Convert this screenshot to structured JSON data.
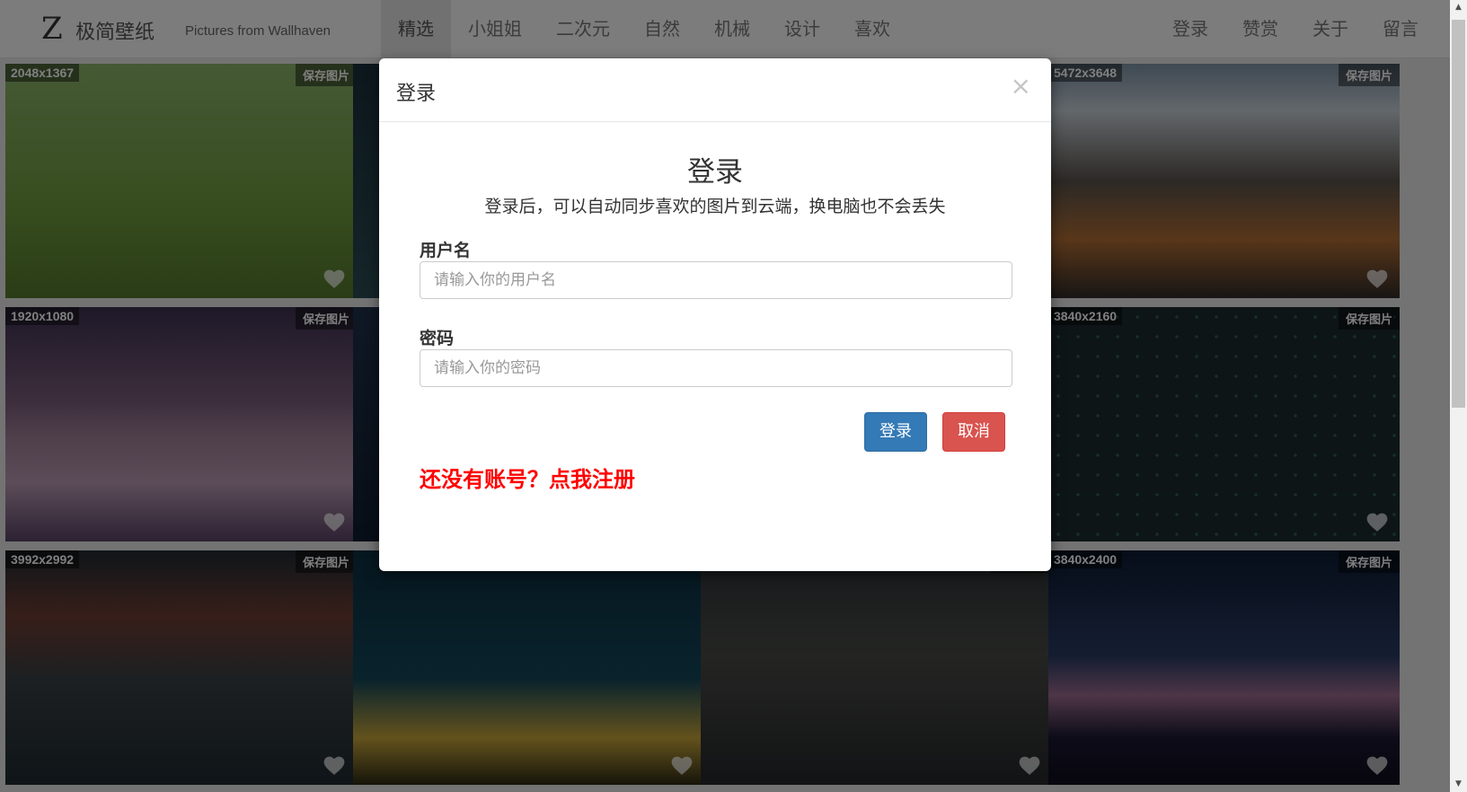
{
  "navbar": {
    "logo": "Z",
    "title": "极简壁纸",
    "subtitle": "Pictures from Wallhaven",
    "left_items": [
      {
        "label": "精选",
        "active": true
      },
      {
        "label": "小姐姐"
      },
      {
        "label": "二次元"
      },
      {
        "label": "自然"
      },
      {
        "label": "机械"
      },
      {
        "label": "设计"
      },
      {
        "label": "喜欢"
      }
    ],
    "right_items": [
      {
        "label": "登录"
      },
      {
        "label": "赞赏"
      },
      {
        "label": "关于"
      },
      {
        "label": "留言"
      }
    ]
  },
  "grid": {
    "save_label": "保存图片",
    "cards": [
      {
        "resolution": "2048x1367",
        "image": "woman-fence-field"
      },
      {
        "resolution": "",
        "image": "dark-abstract"
      },
      {
        "resolution": "",
        "image": "teal-abstract"
      },
      {
        "resolution": "5472x3648",
        "image": "mountain-road"
      },
      {
        "resolution": "1920x1080",
        "image": "pagoda-cherry-blossom"
      },
      {
        "resolution": "",
        "image": "night-sky"
      },
      {
        "resolution": "",
        "image": "dark-blue"
      },
      {
        "resolution": "3840x2160",
        "image": "doodle-pattern"
      },
      {
        "resolution": "3992x2992",
        "image": "sunset-pier"
      },
      {
        "resolution": "",
        "image": "eiffel-tower-night"
      },
      {
        "resolution": "",
        "image": "coastal-cliffs"
      },
      {
        "resolution": "3840x2400",
        "image": "forest-sunset"
      }
    ]
  },
  "modal": {
    "title": "登录",
    "close_icon": "×",
    "heading": "登录",
    "description": "登录后，可以自动同步喜欢的图片到云端，换电脑也不会丢失",
    "username": {
      "label": "用户名",
      "placeholder": "请输入你的用户名",
      "value": ""
    },
    "password": {
      "label": "密码",
      "placeholder": "请输入你的密码",
      "value": ""
    },
    "login_button": "登录",
    "cancel_button": "取消",
    "register_link": "还没有账号？点我注册"
  },
  "colors": {
    "primary": "#337ab7",
    "danger": "#d9534f",
    "register": "#ff0000"
  }
}
